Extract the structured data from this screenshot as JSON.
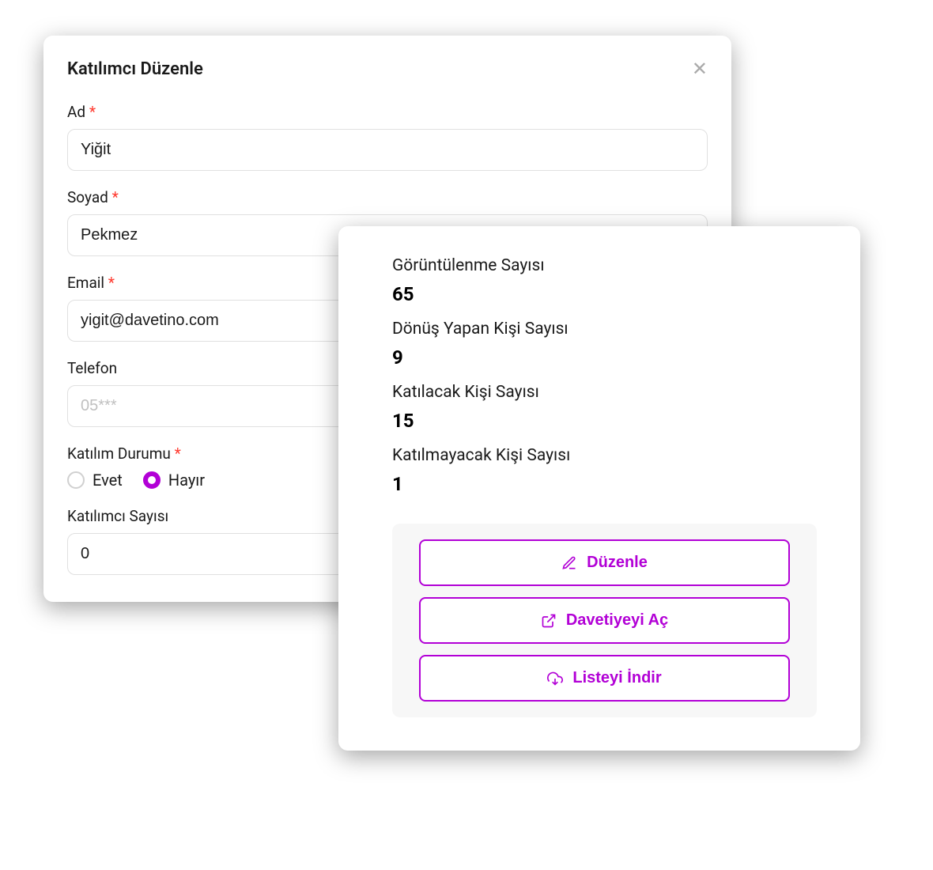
{
  "form": {
    "title": "Katılımcı Düzenle",
    "fields": {
      "firstName": {
        "label": "Ad",
        "value": "Yiğit"
      },
      "lastName": {
        "label": "Soyad",
        "value": "Pekmez"
      },
      "email": {
        "label": "Email",
        "value": "yigit@davetino.com"
      },
      "phone": {
        "label": "Telefon",
        "placeholder": "05***",
        "value": ""
      },
      "attendance": {
        "label": "Katılım Durumu",
        "yes": "Evet",
        "no": "Hayır",
        "selected": "no"
      },
      "count": {
        "label": "Katılımcı Sayısı",
        "value": "0"
      }
    }
  },
  "stats": {
    "views": {
      "label": "Görüntülenme Sayısı",
      "value": "65"
    },
    "responses": {
      "label": "Dönüş Yapan Kişi Sayısı",
      "value": "9"
    },
    "attending": {
      "label": "Katılacak Kişi Sayısı",
      "value": "15"
    },
    "notAttending": {
      "label": "Katılmayacak Kişi Sayısı",
      "value": "1"
    }
  },
  "actions": {
    "edit": "Düzenle",
    "open": "Davetiyeyi Aç",
    "download": "Listeyi İndir"
  }
}
